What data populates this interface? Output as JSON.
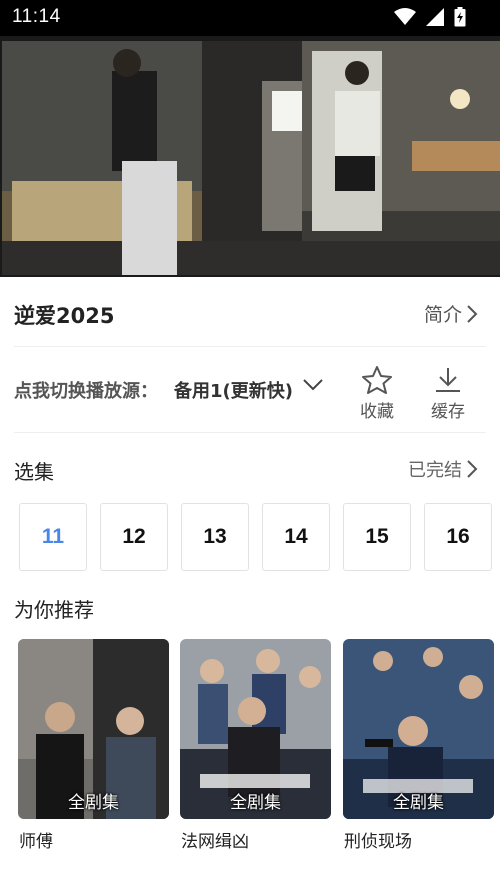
{
  "status_bar": {
    "time": "11:14",
    "icons": [
      "wifi-icon",
      "signal-icon",
      "battery-charging-icon"
    ]
  },
  "video": {
    "description_icon": "video-frame"
  },
  "show": {
    "title": "逆爱2025",
    "intro_label": "简介"
  },
  "source": {
    "label": "点我切换播放源：",
    "value": "备用1(更新快)",
    "favorite_label": "收藏",
    "download_label": "缓存"
  },
  "episodes": {
    "title": "选集",
    "status": "已完结",
    "items": [
      "11",
      "12",
      "13",
      "14",
      "15",
      "16"
    ],
    "active": "11"
  },
  "recommend": {
    "title": "为你推荐",
    "items": [
      {
        "name": "师傅",
        "badge": "全剧集"
      },
      {
        "name": "法网缉凶",
        "badge": "全剧集"
      },
      {
        "name": "刑侦现场",
        "badge": "全剧集"
      }
    ]
  },
  "colors": {
    "accent": "#4a86e8",
    "status_bar": "#000000"
  }
}
